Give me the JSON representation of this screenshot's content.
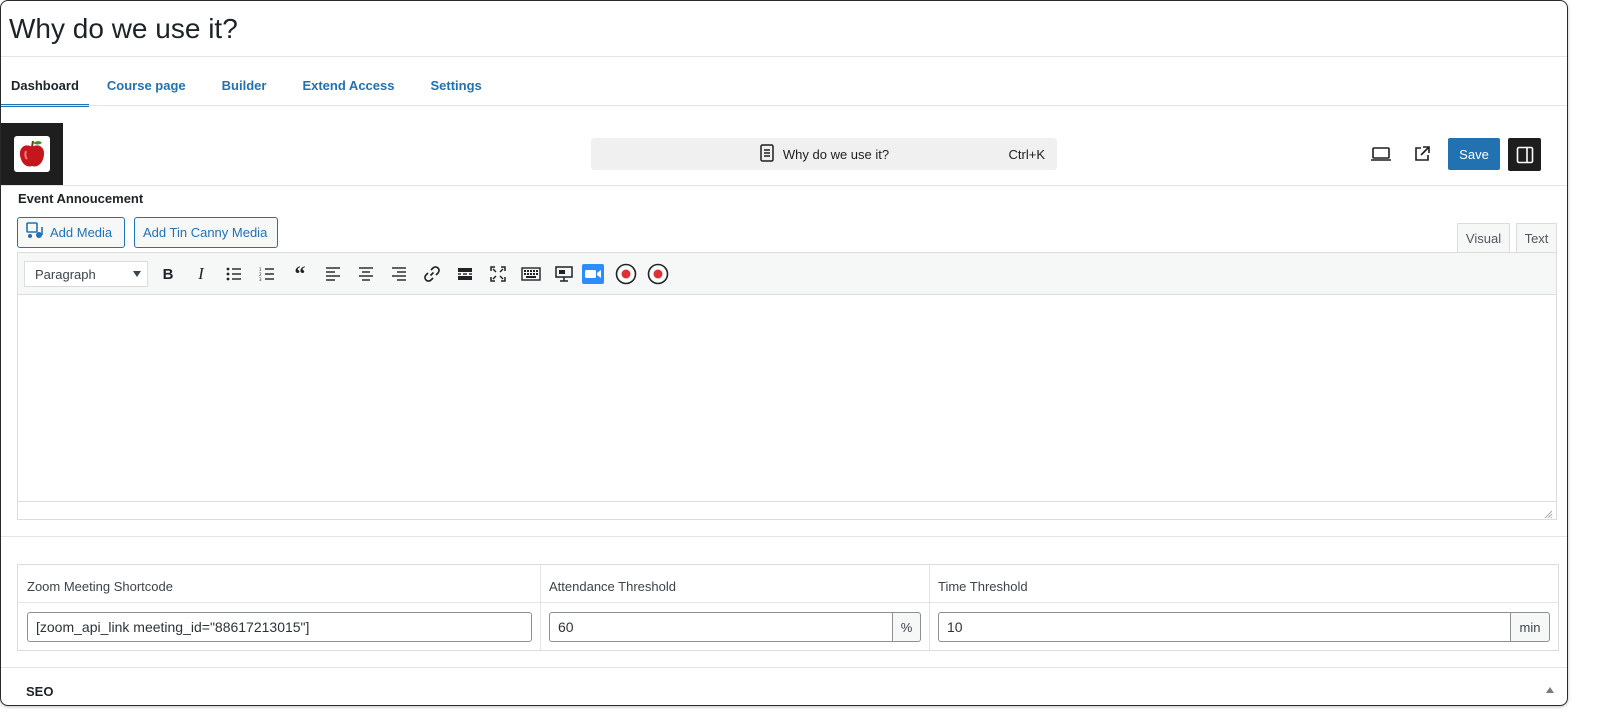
{
  "page": {
    "title": "Why do we use it?"
  },
  "tabs": [
    {
      "label": "Dashboard",
      "active": true
    },
    {
      "label": "Course page"
    },
    {
      "label": "Builder"
    },
    {
      "label": "Extend Access"
    },
    {
      "label": "Settings"
    }
  ],
  "header": {
    "logo_icon": "apple-icon",
    "command_bar": {
      "doc_icon": "document-icon",
      "title": "Why do we use it?",
      "shortcut": "Ctrl+K"
    },
    "preview_icon": "laptop-icon",
    "external_icon": "external-link-icon",
    "save_label": "Save",
    "panel_icon": "sidebar-toggle-icon",
    "accent": "#2271b1"
  },
  "editor": {
    "section_label": "Event Annoucement",
    "add_media_label": "Add Media",
    "add_tin_canny_label": "Add Tin Canny Media",
    "visual_tab": "Visual",
    "text_tab": "Text",
    "format_select": "Paragraph",
    "toolbar_icons": [
      "bold-icon",
      "italic-icon",
      "bullet-list-icon",
      "numbered-list-icon",
      "blockquote-icon",
      "align-left-icon",
      "align-center-icon",
      "align-right-icon",
      "link-icon",
      "read-more-icon",
      "fullscreen-icon",
      "keyboard-icon",
      "presentation-icon",
      "zoom-video-icon",
      "record-icon",
      "record-icon"
    ]
  },
  "fields": {
    "zoom": {
      "label": "Zoom Meeting Shortcode",
      "value": "[zoom_api_link meeting_id=\"88617213015\"]"
    },
    "attendance": {
      "label": "Attendance Threshold",
      "value": "60",
      "unit": "%"
    },
    "time": {
      "label": "Time Threshold",
      "value": "10",
      "unit": "min"
    }
  },
  "seo": {
    "label": "SEO"
  }
}
